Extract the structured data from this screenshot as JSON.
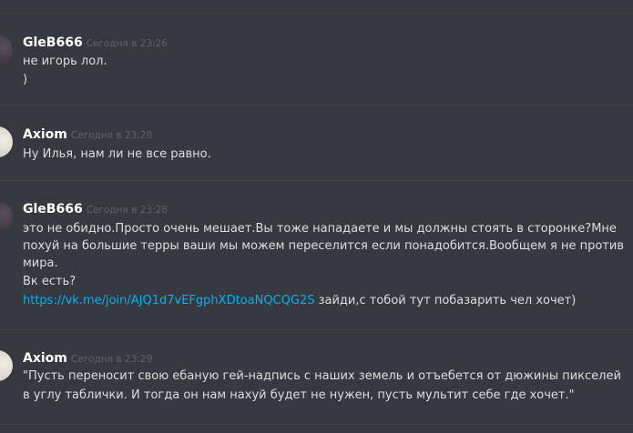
{
  "messages": [
    {
      "username": "GleB666",
      "timestamp": "Сегодня в 23:26",
      "lines": [
        "не игорь лол.",
        ")"
      ]
    },
    {
      "username": "Axiom",
      "timestamp": "Сегодня в 23:28",
      "lines": [
        "Ну Илья, нам ли не все равно."
      ]
    },
    {
      "username": "GleB666",
      "timestamp": "Сегодня в 23:28",
      "lines": [
        "это не обидно.Просто очень мешает.Вы тоже нападаете и мы должны стоять в сторонке?Мне",
        "похуй на большие терры ваши мы можем переселится если понадобится.Вообщем я не против",
        "мира.",
        "Вк есть?"
      ],
      "link": "https://vk.me/join/AJQ1d7vEFgphXDtoaNQCQG2S",
      "after_link": " зайди,с тобой тут побазарить чел хочет)"
    },
    {
      "username": "Axiom",
      "timestamp": "Сегодня в 23:29",
      "lines": [
        "\"Пусть переносит свою ебаную гей-надпись с наших земель и отъебется от дюжины пикселей",
        "в углу таблички. И тогда он нам нахуй будет не нужен, пусть мультит себе где хочет.\""
      ]
    }
  ]
}
